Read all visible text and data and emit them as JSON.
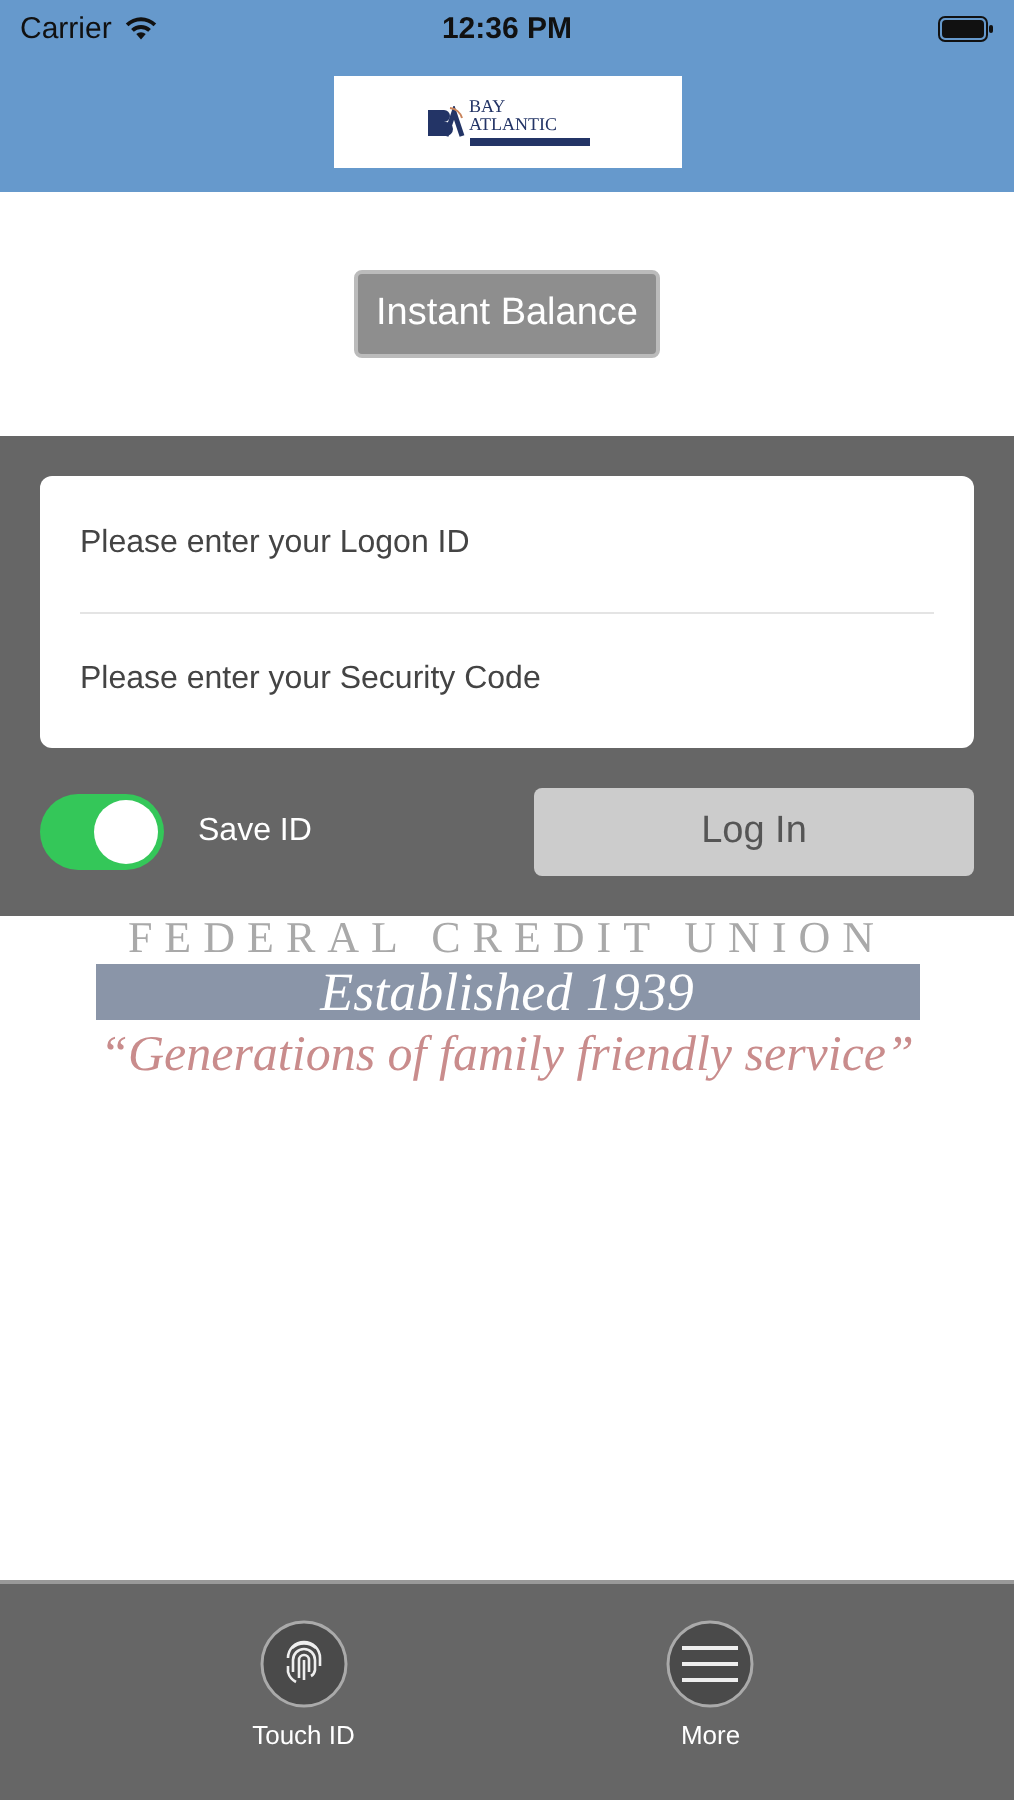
{
  "status_bar": {
    "carrier": "Carrier",
    "time": "12:36 PM"
  },
  "header": {
    "logo": {
      "line_1": "BAY",
      "line_2": "ATLANTIC"
    }
  },
  "instant_balance_button": "Instant Balance",
  "login_form": {
    "fields": [
      {
        "placeholder": "Please enter your Logon ID"
      },
      {
        "placeholder": "Please enter your Security Code"
      }
    ],
    "save_id": {
      "label": "Save ID",
      "on": true
    },
    "login_button": "Log In"
  },
  "background_logo": {
    "line_1": "FEDERAL CREDIT UNION",
    "line_2": "Established 1939",
    "tagline": "“Generations of family friendly service”"
  },
  "tab_bar": [
    {
      "kind": "fingerprint",
      "label": "Touch ID"
    },
    {
      "kind": "menu",
      "label": "More"
    }
  ]
}
